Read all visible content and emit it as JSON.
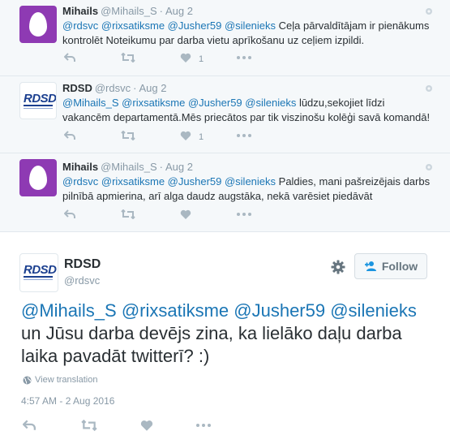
{
  "thread": [
    {
      "name": "Mihails",
      "handle": "@Mihails_S",
      "date": "Aug 2",
      "avatar": "egg",
      "mentions": "@rdsvc @rixsatiksme @Jusher59 @silenieks",
      "text": " Ceļa pārvaldītājam ir pienākums kontrolēt Noteikumu par darba vietu aprīkošanu uz ceļiem izpildi.",
      "like_count": "1"
    },
    {
      "name": "RDSD",
      "handle": "@rdsvc",
      "date": "Aug 2",
      "avatar": "rdsd",
      "mentions": "@Mihails_S @rixsatiksme @Jusher59 @silenieks",
      "text": " lūdzu,sekojiet līdzi vakancēm departamentā.Mēs priecātos par tik viszinošu kolēģi savā komandā!",
      "like_count": "1"
    },
    {
      "name": "Mihails",
      "handle": "@Mihails_S",
      "date": "Aug 2",
      "avatar": "egg",
      "mentions": "@rdsvc @rixsatiksme @Jusher59 @silenieks",
      "text": " Paldies, mani pašreizējais darbs pilnībā apmierina, arī alga daudz augstāka, nekā varēsiet piedāvāt",
      "like_count": ""
    }
  ],
  "main": {
    "name": "RDSD",
    "handle": "@rdsvc",
    "follow_label": "Follow",
    "mentions": "@Mihails_S @rixsatiksme @Jusher59 @silenieks",
    "text": " un Jūsu darba devējs zina, ka lielāko daļu darba laika pavadāt twitterī? :)",
    "view_translation": "View translation",
    "timestamp": "4:57 AM - 2 Aug 2016"
  },
  "logo_text": "RDSD",
  "icons": [
    "reply-icon",
    "retweet-icon",
    "heart-icon",
    "more-icon",
    "gear-icon",
    "follow-person-icon",
    "globe-icon"
  ],
  "colors": {
    "link": "#1b76b5",
    "muted": "#8899a6",
    "thread_bg": "#f5f8fa",
    "egg_avatar": "#8e3ab3"
  }
}
